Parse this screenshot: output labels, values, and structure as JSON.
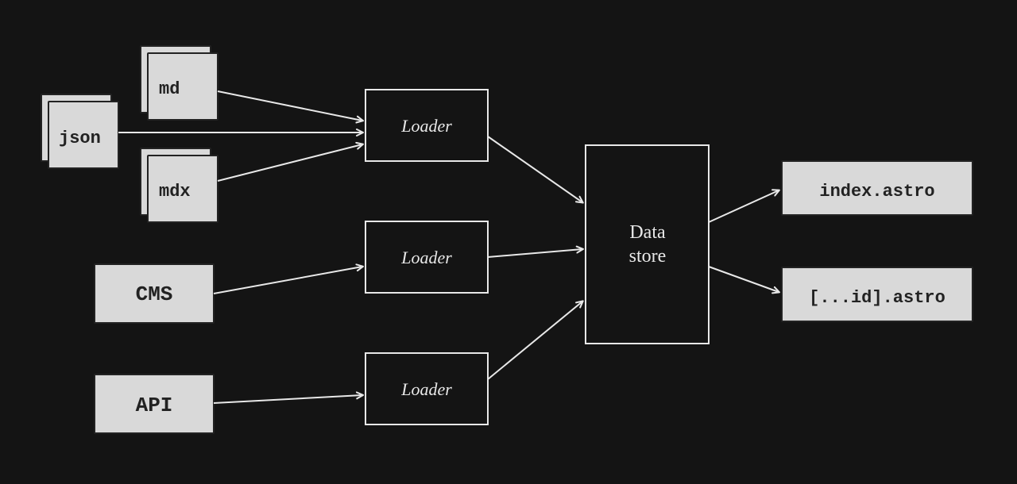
{
  "sources": {
    "md": {
      "label": "md"
    },
    "json": {
      "label": "json"
    },
    "mdx": {
      "label": "mdx"
    },
    "cms": {
      "label": "CMS"
    },
    "api": {
      "label": "API"
    }
  },
  "loaders": {
    "a": {
      "label": "Loader"
    },
    "b": {
      "label": "Loader"
    },
    "c": {
      "label": "Loader"
    }
  },
  "store": {
    "line1": "Data",
    "line2": "store"
  },
  "pages": {
    "index": {
      "label": "index.astro"
    },
    "id": {
      "label": "[...id].astro"
    }
  }
}
